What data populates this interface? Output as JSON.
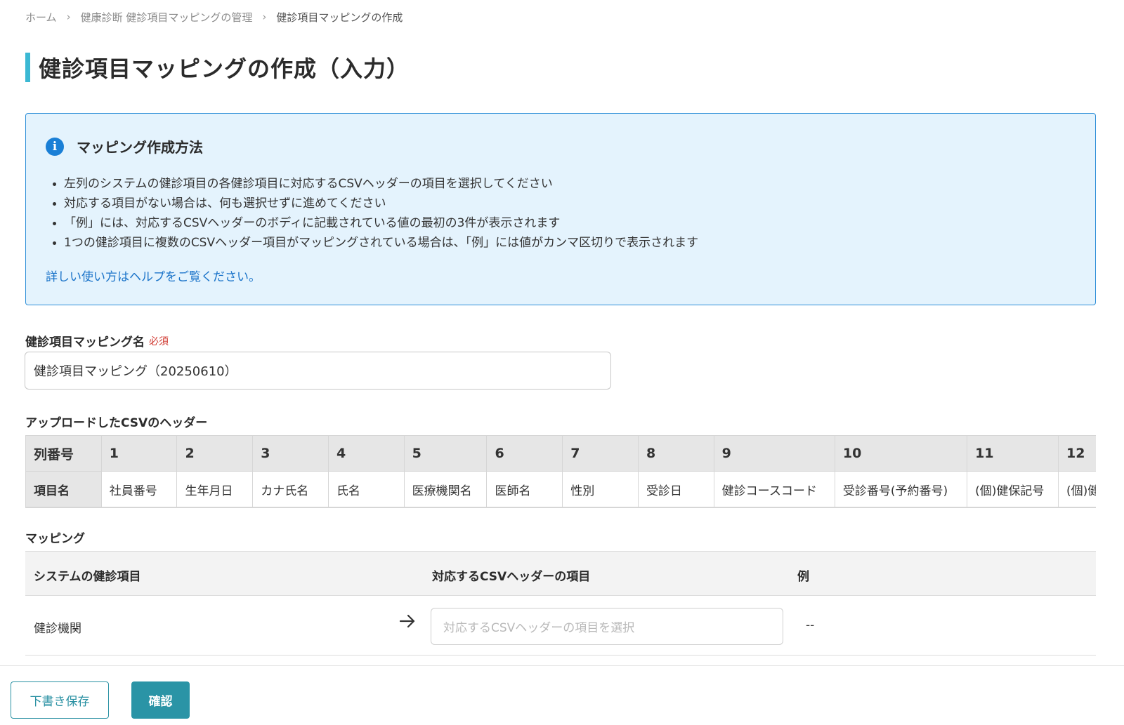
{
  "breadcrumb": {
    "home": "ホーム",
    "parent": "健康診断 健診項目マッピングの管理",
    "current": "健診項目マッピングの作成",
    "separator": "›"
  },
  "page_title": "健診項目マッピングの作成（入力）",
  "info": {
    "icon": "info-icon",
    "title": "マッピング作成方法",
    "bullets": [
      "左列のシステムの健診項目の各健診項目に対応するCSVヘッダーの項目を選択してください",
      "対応する項目がない場合は、何も選択せずに進めてください",
      "「例」には、対応するCSVヘッダーのボディに記載されている値の最初の3件が表示されます",
      "1つの健診項目に複数のCSVヘッダー項目がマッピングされている場合は、「例」には値がカンマ区切りで表示されます"
    ],
    "help_link": "詳しい使い方はヘルプをご覧ください。"
  },
  "mapping_name": {
    "label": "健診項目マッピング名",
    "required": "必須",
    "value": "健診項目マッピング（20250610）"
  },
  "csv_headers": {
    "label": "アップロードしたCSVのヘッダー",
    "row_heads": [
      "列番号",
      "項目名"
    ],
    "numbers": [
      "1",
      "2",
      "3",
      "4",
      "5",
      "6",
      "7",
      "8",
      "9",
      "10",
      "11",
      "12"
    ],
    "names": [
      "社員番号",
      "生年月日",
      "カナ氏名",
      "氏名",
      "医療機関名",
      "医師名",
      "性別",
      "受診日",
      "健診コースコード",
      "受診番号(予約番号)",
      "(個)健保記号",
      "(個)健保番号"
    ]
  },
  "mapping": {
    "label": "マッピング",
    "columns": [
      "システムの健診項目",
      "対応するCSVヘッダーの項目",
      "例"
    ],
    "rows": [
      {
        "item": "健診機関",
        "select_placeholder": "対応するCSVヘッダーの項目を選択",
        "example": "--"
      }
    ]
  },
  "footer": {
    "draft_button": "下書き保存",
    "confirm_button": "確認"
  },
  "colors": {
    "accent": "#3bb8d3",
    "info_border": "#2f8fd8",
    "info_bg": "#e4f3fd",
    "primary_button": "#2a94a6",
    "required": "#d0382f"
  }
}
